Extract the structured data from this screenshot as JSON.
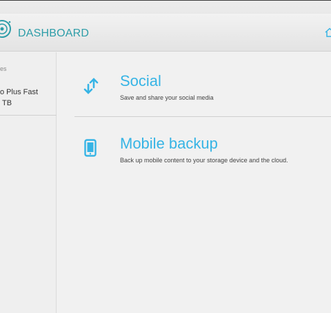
{
  "header": {
    "brand": "DASHBOARD",
    "logo_icon": "wd-logo-icon",
    "home_icon": "home-icon"
  },
  "sidebar": {
    "heading": "es",
    "device": {
      "name_line1": "o Plus Fast",
      "name_line2": "TB"
    }
  },
  "apps": [
    {
      "title": "Social",
      "description": "Save and share your social media",
      "icon": "share-arrows-icon"
    },
    {
      "title": "Mobile backup",
      "description": "Back up mobile content to your storage device and the cloud.",
      "icon": "phone-icon"
    }
  ],
  "colors": {
    "accent": "#36b4e5",
    "brand": "#2d9da8",
    "background": "#f1f1f1"
  }
}
